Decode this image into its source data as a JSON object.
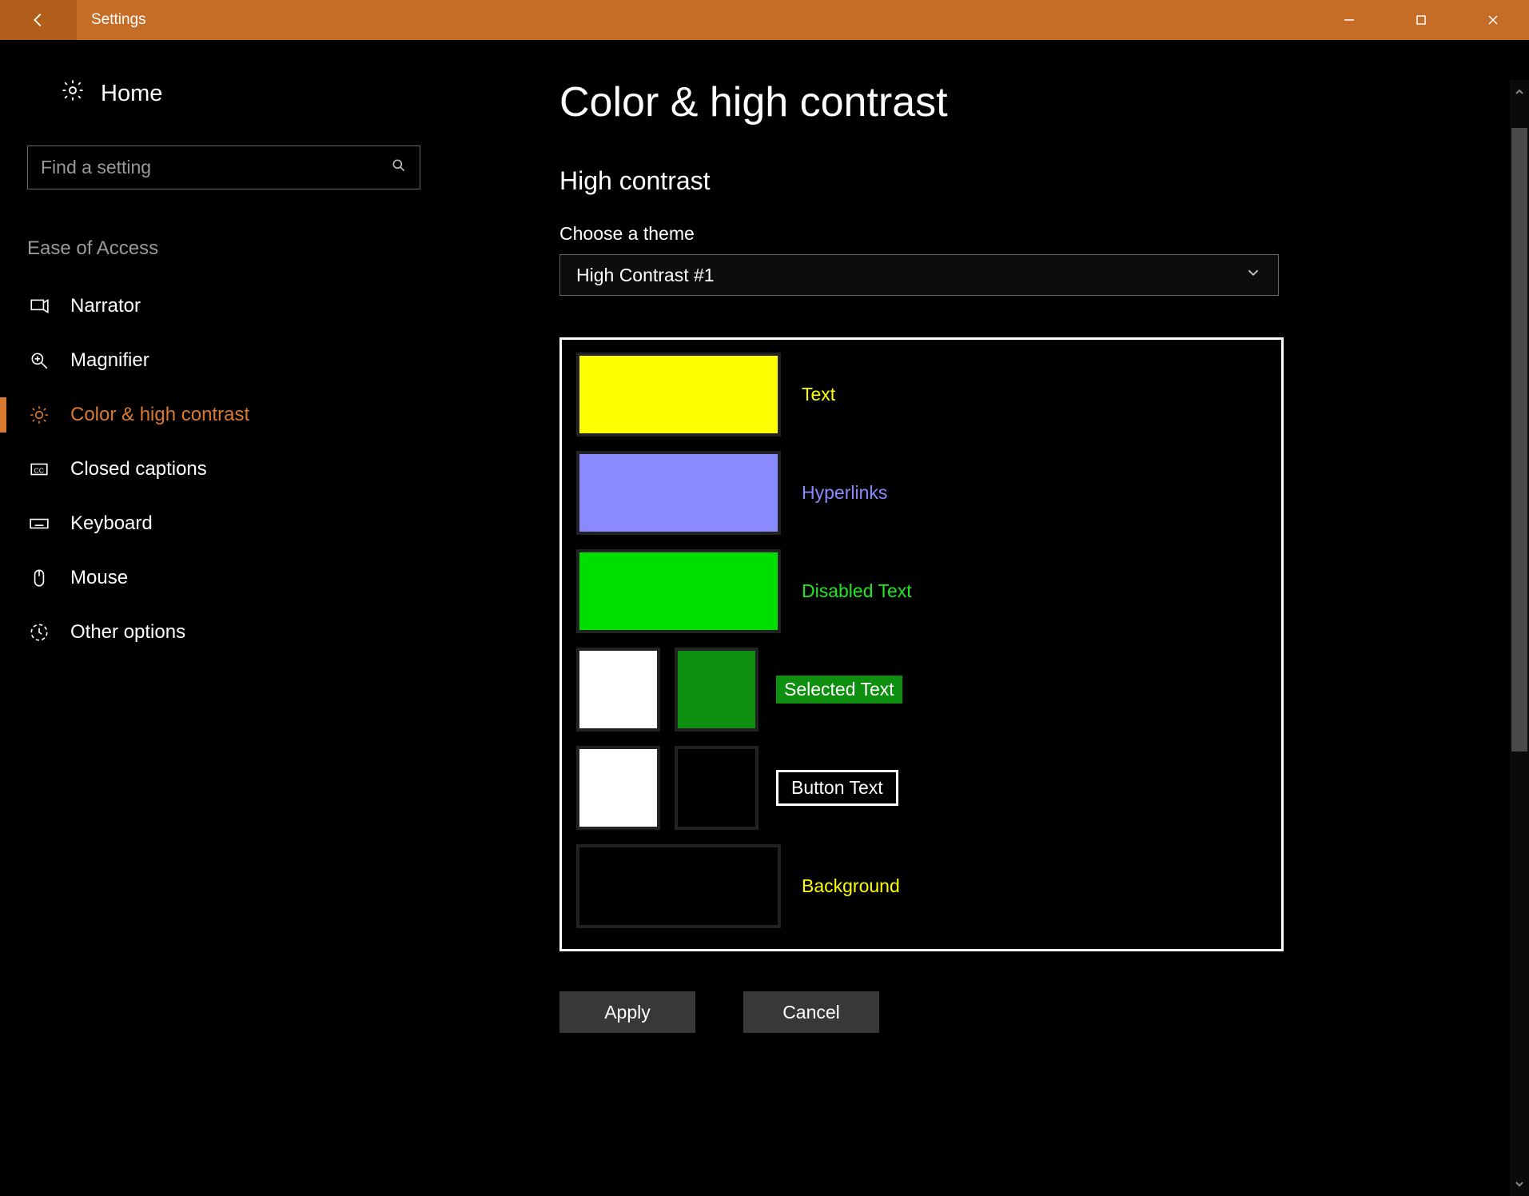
{
  "titlebar": {
    "title": "Settings"
  },
  "sidebar": {
    "home_label": "Home",
    "search_placeholder": "Find a setting",
    "category_label": "Ease of Access",
    "items": [
      {
        "id": "narrator",
        "label": "Narrator"
      },
      {
        "id": "magnifier",
        "label": "Magnifier"
      },
      {
        "id": "color",
        "label": "Color & high contrast",
        "selected": true
      },
      {
        "id": "captions",
        "label": "Closed captions"
      },
      {
        "id": "keyboard",
        "label": "Keyboard"
      },
      {
        "id": "mouse",
        "label": "Mouse"
      },
      {
        "id": "other",
        "label": "Other options"
      }
    ]
  },
  "main": {
    "page_title": "Color & high contrast",
    "section_title": "High contrast",
    "theme_label": "Choose a theme",
    "theme_value": "High Contrast #1",
    "preview": {
      "text": {
        "label": "Text",
        "color": "#ffff00"
      },
      "hyperlinks": {
        "label": "Hyperlinks",
        "color": "#8a8aff"
      },
      "disabled": {
        "label": "Disabled Text",
        "color": "#00e000"
      },
      "selected": {
        "label": "Selected Text",
        "fg": "#ffffff",
        "bg": "#0f8f0f"
      },
      "button": {
        "label": "Button Text",
        "fg": "#ffffff",
        "bg": "#000000"
      },
      "background": {
        "label": "Background",
        "color": "#000000"
      }
    },
    "buttons": {
      "apply": "Apply",
      "cancel": "Cancel"
    }
  }
}
